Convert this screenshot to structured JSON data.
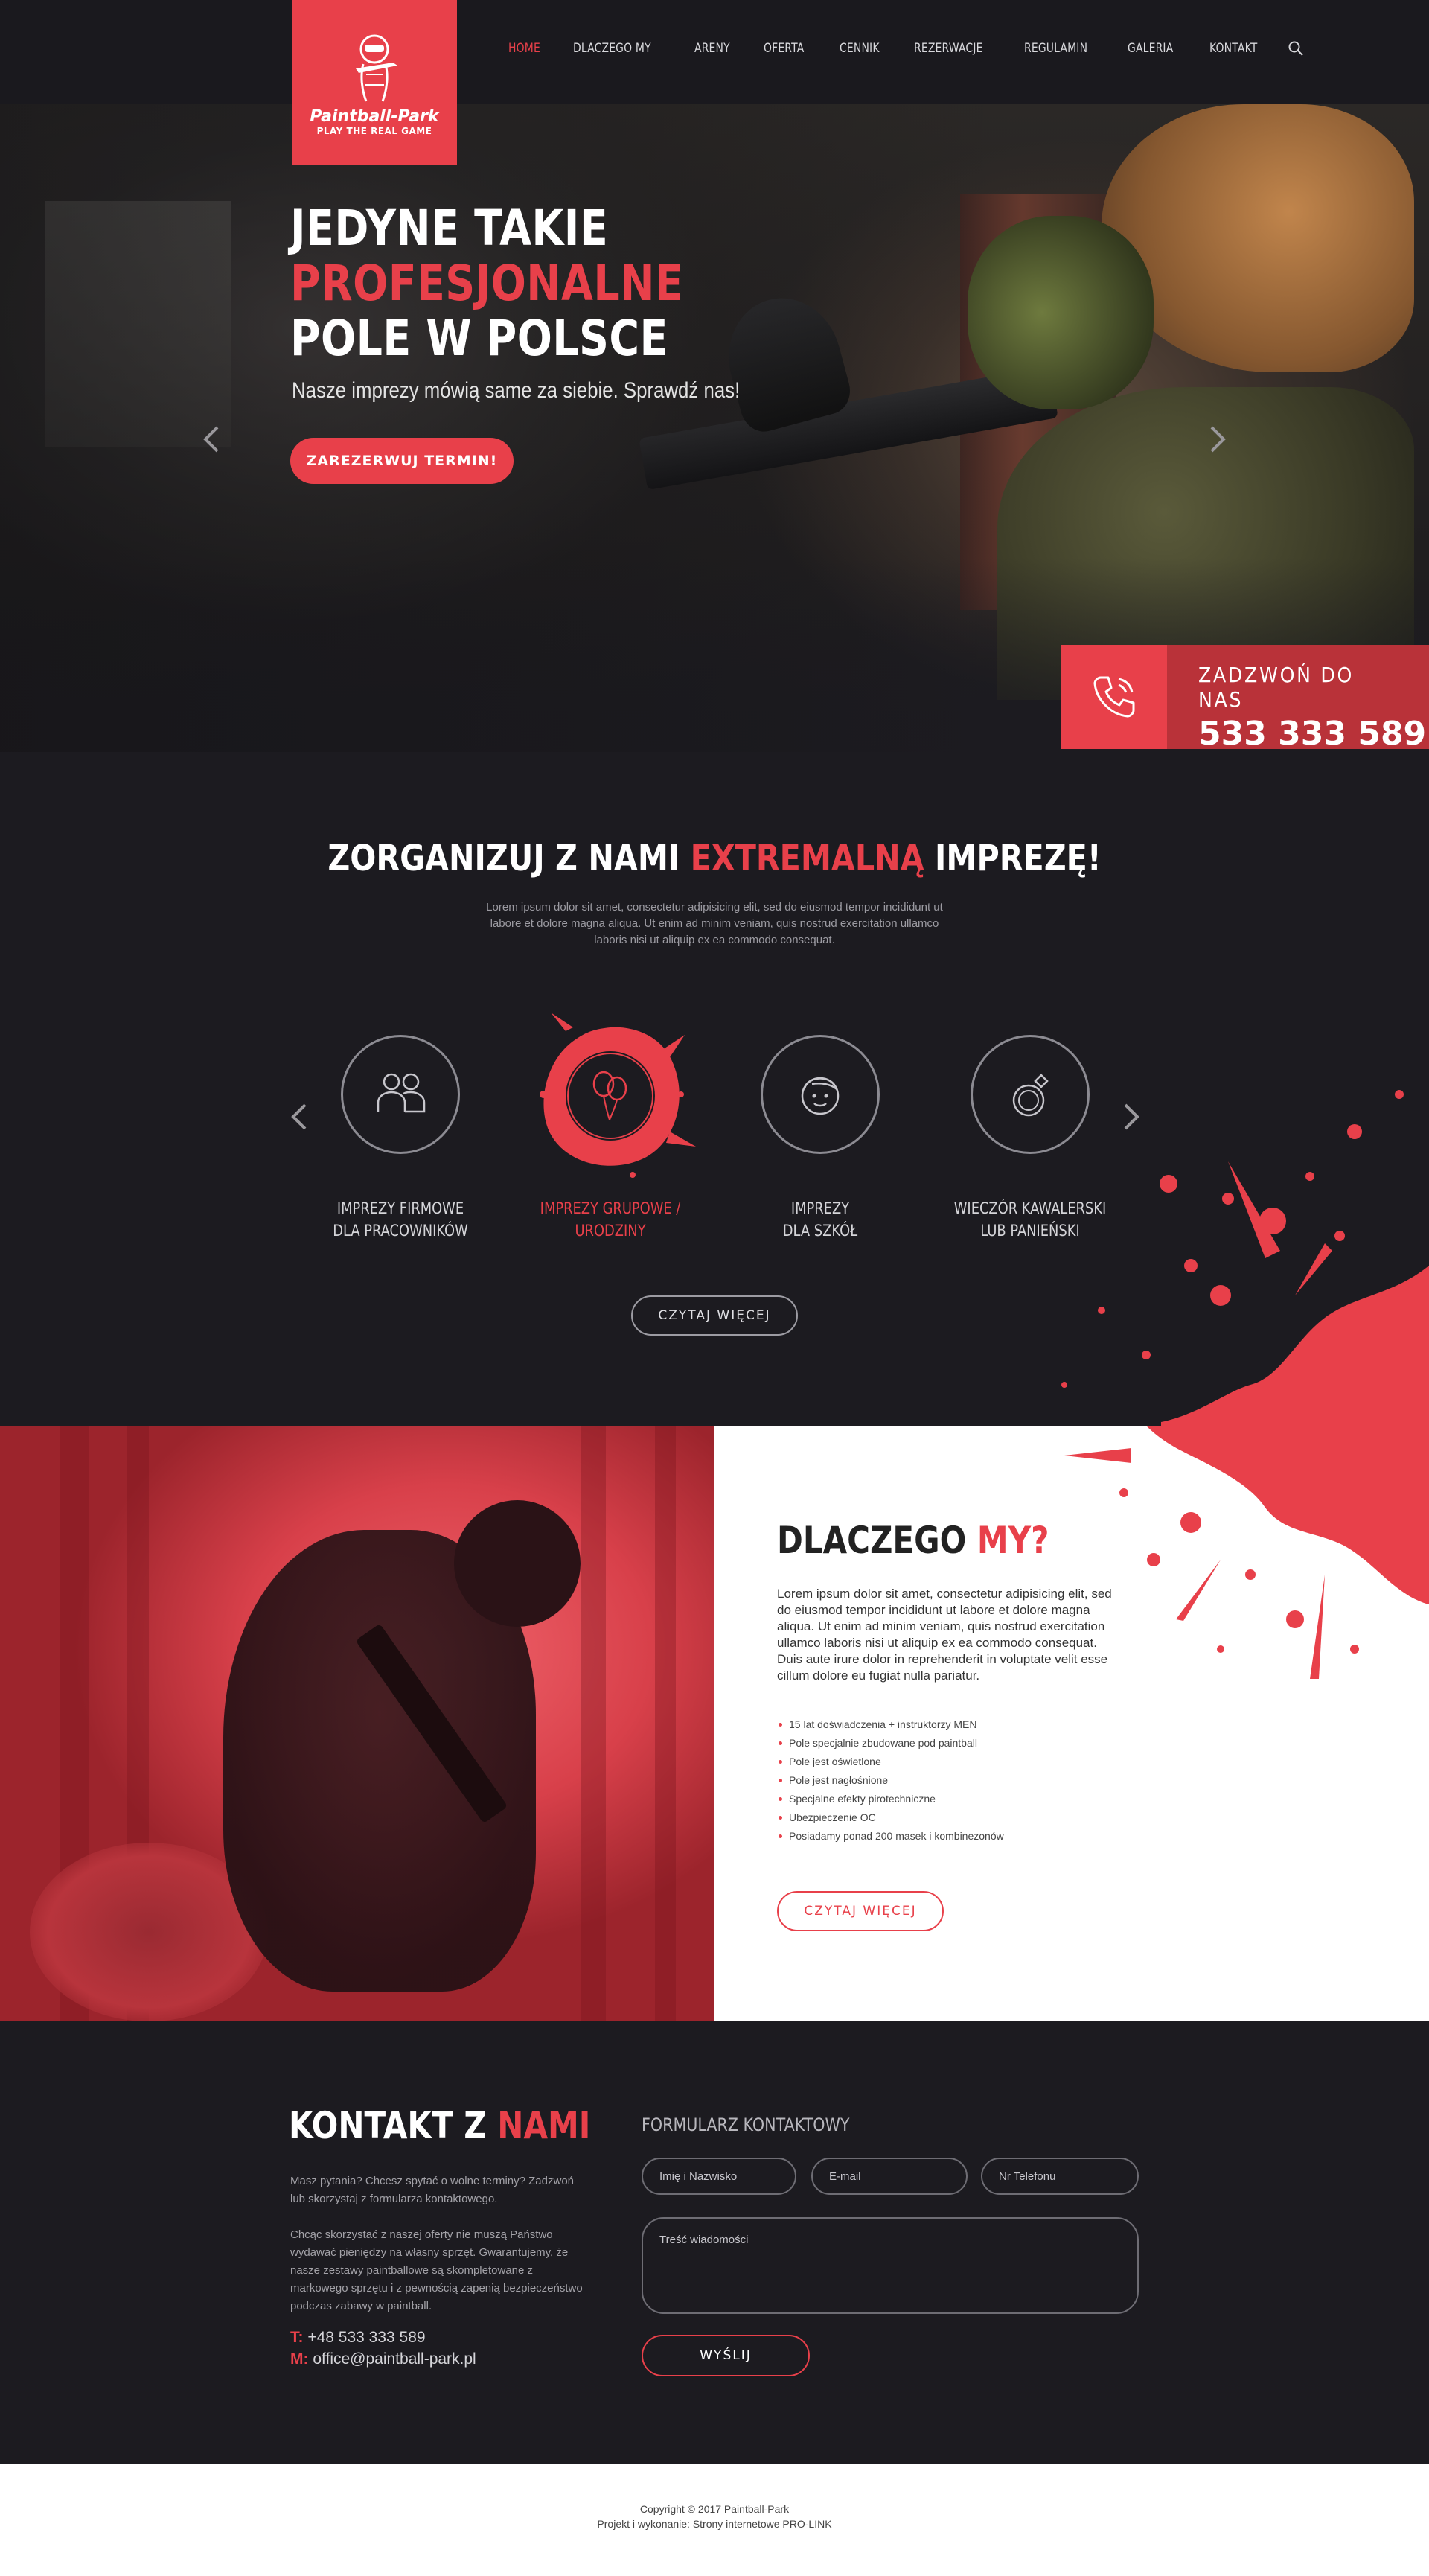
{
  "brand": {
    "name": "Paintball-Park",
    "tagline": "PLAY THE REAL GAME",
    "accent": "#e8404a",
    "dark_bg": "#1c1b20"
  },
  "nav": {
    "items": [
      "HOME",
      "DLACZEGO MY",
      "ARENY",
      "OFERTA",
      "CENNIK",
      "REZERWACJE",
      "REGULAMIN",
      "GALERIA",
      "KONTAKT"
    ],
    "active": "HOME",
    "search_icon": "search-icon"
  },
  "hero": {
    "line1": "JEDYNE TAKIE",
    "line2": "PROFESJONALNE",
    "line3": "POLE W POLSCE",
    "subtitle": "Nasze imprezy mówią same za siebie. Sprawdź nas!",
    "cta": "ZAREZERWUJ TERMIN!",
    "call_label": "ZADZWOŃ DO NAS",
    "call_number": "533 333 589"
  },
  "events": {
    "title_pre": "ZORGANIZUJ Z NAMI ",
    "title_red": "EXTREMALNĄ",
    "title_post": " IMPREZĘ!",
    "description": "Lorem ipsum dolor sit amet, consectetur adipisicing elit, sed do eiusmod tempor incididunt ut labore et dolore magna aliqua. Ut enim ad minim veniam, quis nostrud exercitation ullamco laboris nisi ut aliquip ex ea commodo consequat.",
    "items": [
      {
        "line1": "IMPREZY FIRMOWE",
        "line2": "DLA PRACOWNIKÓW",
        "icon": "people-icon"
      },
      {
        "line1": "IMPREZY GRUPOWE /",
        "line2": "URODZINY",
        "icon": "balloons-icon"
      },
      {
        "line1": "IMPREZY",
        "line2": "DLA SZKÓŁ",
        "icon": "child-face-icon"
      },
      {
        "line1": "WIECZÓR KAWALERSKI",
        "line2": "LUB PANIEŃSKI",
        "icon": "ring-icon"
      }
    ],
    "more": "CZYTAJ WIĘCEJ"
  },
  "why": {
    "title_pre": "DLACZEGO ",
    "title_red": "MY?",
    "text": "Lorem ipsum dolor sit amet, consectetur adipisicing elit, sed do eiusmod tempor incididunt ut labore et dolore magna aliqua. Ut enim ad minim veniam, quis nostrud exercitation ullamco laboris nisi ut aliquip ex ea commodo consequat. Duis aute irure dolor in reprehenderit in voluptate velit esse cillum dolore eu fugiat nulla pariatur.",
    "list": [
      "15 lat doświadczenia + instruktorzy MEN",
      "Pole specjalnie zbudowane pod paintball",
      "Pole jest oświetlone",
      "Pole jest nagłośnione",
      "Specjalne efekty pirotechniczne",
      "Ubezpieczenie OC",
      "Posiadamy ponad 200 masek i kombinezonów"
    ],
    "more": "CZYTAJ WIĘCEJ"
  },
  "contact": {
    "title_pre": "KONTAKT Z ",
    "title_red": "NAMI",
    "p1": "Masz pytania? Chcesz spytać o wolne terminy? Zadzwoń lub skorzystaj z formularza kontaktowego.",
    "p2": "Chcąc skorzystać z naszej oferty nie muszą Państwo wydawać pieniędzy na własny sprzęt. Gwarantujemy, że nasze zestawy paintballowe są skompletowane z markowego sprzętu i z pewnością zapenią bezpieczeństwo podczas zabawy w paintball.",
    "phone_label": "T:",
    "phone": "+48 533 333 589",
    "mail_label": "M:",
    "mail": "office@paintball-park.pl"
  },
  "form": {
    "title": "FORMULARZ KONTAKTOWY",
    "name_placeholder": "Imię i Nazwisko",
    "email_placeholder": "E-mail",
    "phone_placeholder": "Nr Telefonu",
    "message_placeholder": "Treść wiadomości",
    "submit": "WYŚLIJ"
  },
  "footer": {
    "copyright": "Copyright © 2017 Paintball-Park",
    "credits": "Projekt i wykonanie: Strony internetowe PRO-LINK"
  }
}
